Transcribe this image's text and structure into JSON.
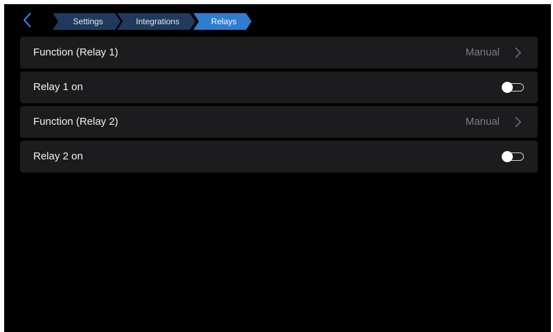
{
  "breadcrumb": {
    "items": [
      {
        "label": "Settings",
        "active": false
      },
      {
        "label": "Integrations",
        "active": false
      },
      {
        "label": "Relays",
        "active": true
      }
    ]
  },
  "rows": [
    {
      "label": "Function (Relay 1)",
      "value": "Manual",
      "kind": "chevron"
    },
    {
      "label": "Relay 1 on",
      "toggle_on": false,
      "kind": "toggle"
    },
    {
      "label": "Function (Relay 2)",
      "value": "Manual",
      "kind": "chevron"
    },
    {
      "label": "Relay 2 on",
      "toggle_on": false,
      "kind": "toggle"
    }
  ],
  "icons": {
    "back": "chevron-left-icon",
    "row_chevron": "chevron-right-icon"
  },
  "colors": {
    "background": "#000000",
    "row_background": "#1c1c1e",
    "crumb_inactive": "#1f3a5c",
    "crumb_active": "#2f7dd1",
    "back_arrow": "#3d8bff",
    "value_text": "#7d7d80"
  }
}
